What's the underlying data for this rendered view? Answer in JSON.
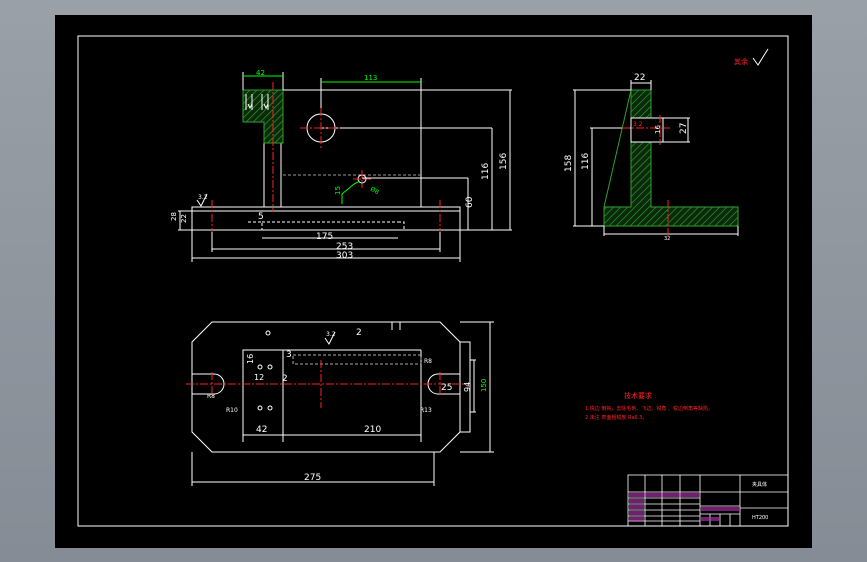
{
  "colors": {
    "viewport_bg": "#8e949e",
    "sheet_bg": "#000000",
    "line": "#ffffff",
    "hatch": "#1f8a1f",
    "dimension": "#00ff00",
    "center_line": "#ff2020",
    "note": "#ff2020",
    "table_text": "#ff40ff",
    "title_text": "#ffffff"
  },
  "front_view": {
    "dims": {
      "d42": "42",
      "d113": "113",
      "d156": "156",
      "d116": "116",
      "d60": "60",
      "d15": "15",
      "d28": "28",
      "d22": "22",
      "d5": "5",
      "d175": "175",
      "d253": "253",
      "d303": "303",
      "d38": "Ø8",
      "rough": "3.2"
    }
  },
  "side_view": {
    "dims": {
      "d22": "22",
      "d27": "27",
      "d158": "158",
      "d116": "116",
      "d16": "16",
      "d32": "32",
      "rough": "3.2"
    }
  },
  "top_view": {
    "dims": {
      "d2a": "2",
      "d3": "3",
      "d12": "12",
      "d2b": "2",
      "d16": "16",
      "r8a": "R8",
      "r10": "R10",
      "r8b": "R8",
      "r13": "R13",
      "d25": "25",
      "d94": "94",
      "d150": "150",
      "d42": "42",
      "d210": "210",
      "d275": "275",
      "rough": "3.2"
    }
  },
  "tech_notes": {
    "title": "技术要求",
    "line1": "1.锐边 倒钝，去除毛刺、飞边、锐角 、锐边倒角等缺陷。",
    "line2": "2.未注 表面粗糙度 Ra6.3。"
  },
  "title_block": {
    "drawing_name": "夹具体",
    "material": "HT200"
  },
  "roughness_mark": {
    "label": "其余"
  }
}
